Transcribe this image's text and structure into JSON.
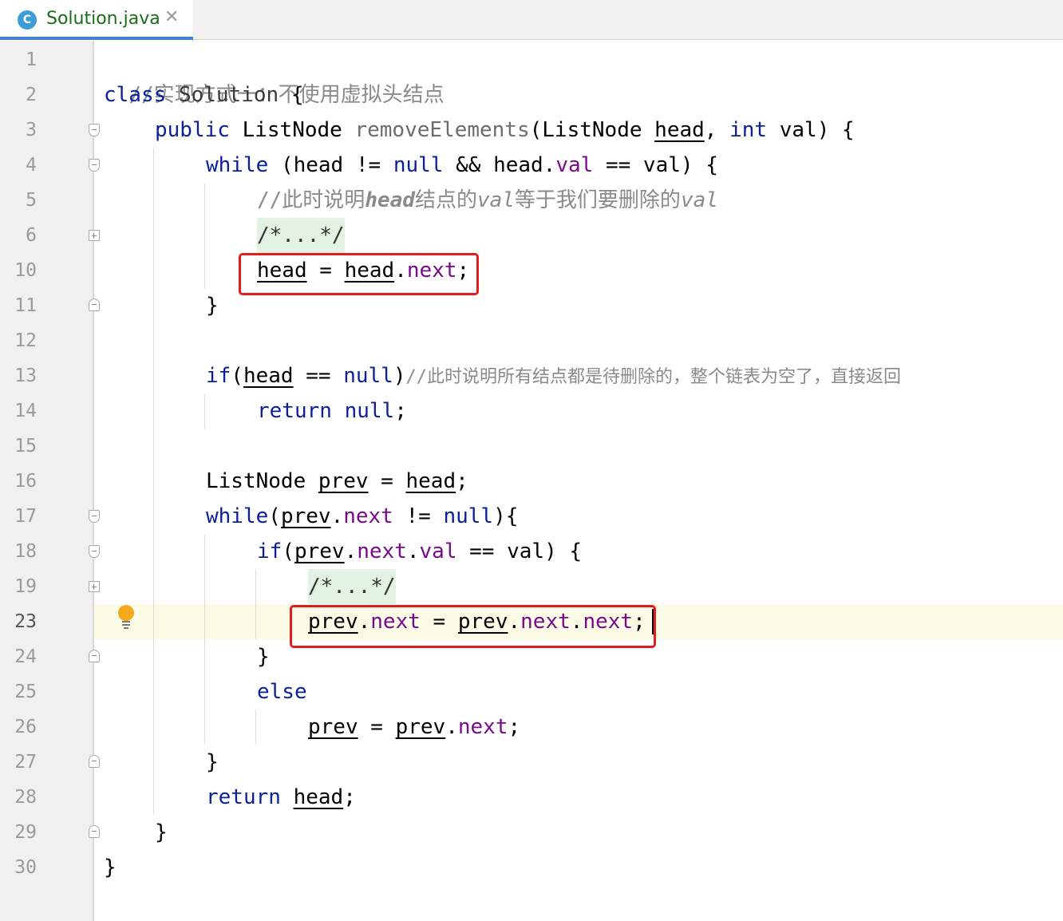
{
  "tab": {
    "icon_letter": "C",
    "title": "Solution.java",
    "close": "✕"
  },
  "colors": {
    "keyword": "#0a1f9e",
    "field": "#7a0a8c",
    "comment": "#8a8a8a",
    "highlight_box": "#e41b1b",
    "current_line": "#fbfbe6",
    "folded_region": "#e3f3e3"
  },
  "editor": {
    "current_line": "23",
    "line_numbers": [
      "1",
      "2",
      "3",
      "4",
      "5",
      "6",
      "10",
      "11",
      "12",
      "13",
      "14",
      "15",
      "16",
      "17",
      "18",
      "19",
      "23",
      "24",
      "25",
      "26",
      "27",
      "28",
      "29",
      "30"
    ],
    "code": {
      "l1": "//实现方式一：不使用虚拟头结点",
      "l2_kw": "class",
      "l2_name": "Solution",
      "l2_brace": "{",
      "l3_kw": "public",
      "l3_type": "ListNode",
      "l3_fn": "removeElements",
      "l3_open": "(ListNode",
      "l3_param": "head",
      "l3_comma": ",",
      "l3_int": "int",
      "l3_rest": "val) {",
      "l4_kw": "while",
      "l4_a": "(head != ",
      "l4_null": "null",
      "l4_b": " && head.",
      "l4_val": "val",
      "l4_c": " == val) {",
      "l5_a": "//此时说明",
      "l5_head": "head",
      "l5_b": "结点的",
      "l5_val": "val",
      "l5_c": "等于我们要删除的",
      "l5_val2": "val",
      "folded": "/*...*/",
      "l10_head": "head",
      "l10_eq": " = ",
      "l10_head2": "head",
      "l10_dot": ".",
      "l10_next": "next",
      "l10_semi": ";",
      "close_brace": "}",
      "l13_if": "if",
      "l13_paren": "(",
      "l13_head": "head",
      "l13_eq": " == ",
      "l13_null": "null",
      "l13_close": ")",
      "l13_cmt": "//此时说明所有结点都是待删除的，整个链表为空了，直接返回",
      "l14_return": "return",
      "l14_null": "null",
      "l14_semi": ";",
      "l16_type": "ListNode ",
      "l16_prev": "prev",
      "l16_eq": " = ",
      "l16_head": "head",
      "l16_semi": ";",
      "l17_while": "while",
      "l17_paren": "(",
      "l17_prev": "prev",
      "l17_dot": ".",
      "l17_next": "next",
      "l17_ne": " != ",
      "l17_null": "null",
      "l17_close": "){",
      "l18_if": "if",
      "l18_paren": "(",
      "l18_prev": "prev",
      "l18_dot": ".",
      "l18_next": "next",
      "l18_dot2": ".",
      "l18_val": "val",
      "l18_rest": " == val) {",
      "l23_prev": "prev",
      "l23_dot": ".",
      "l23_next": "next",
      "l23_eq": " = ",
      "l23_prev2": "prev",
      "l23_dot2": ".",
      "l23_next2": "next",
      "l23_dot3": ".",
      "l23_next3": "next",
      "l23_semi": ";",
      "l25_else": "else",
      "l26_prev": "prev",
      "l26_eq": " = ",
      "l26_prev2": "prev",
      "l26_dot": ".",
      "l26_next": "next",
      "l26_semi": ";",
      "l28_return": "return",
      "l28_head": "head",
      "l28_semi": ";"
    }
  }
}
